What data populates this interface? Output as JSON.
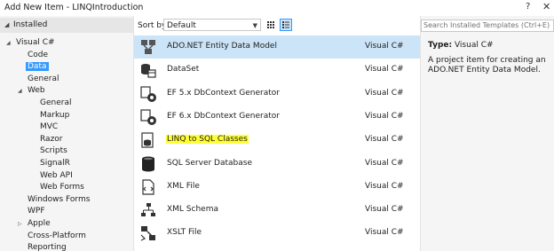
{
  "window": {
    "title": "Add New Item - LINQIntroduction",
    "help": "?",
    "close": "✕"
  },
  "tree": {
    "header": "Installed",
    "items": [
      {
        "label": "Visual C#",
        "indent": 1,
        "expander": "expanded"
      },
      {
        "label": "Code",
        "indent": 2
      },
      {
        "label": "Data",
        "indent": 2,
        "selected": true
      },
      {
        "label": "General",
        "indent": 2
      },
      {
        "label": "Web",
        "indent": 2,
        "expander": "expanded"
      },
      {
        "label": "General",
        "indent": 3
      },
      {
        "label": "Markup",
        "indent": 3
      },
      {
        "label": "MVC",
        "indent": 3
      },
      {
        "label": "Razor",
        "indent": 3
      },
      {
        "label": "Scripts",
        "indent": 3
      },
      {
        "label": "SignalR",
        "indent": 3
      },
      {
        "label": "Web API",
        "indent": 3
      },
      {
        "label": "Web Forms",
        "indent": 3
      },
      {
        "label": "Windows Forms",
        "indent": 2
      },
      {
        "label": "WPF",
        "indent": 2
      },
      {
        "label": "Apple",
        "indent": 2,
        "expander": "collapsed"
      },
      {
        "label": "Cross-Platform",
        "indent": 2
      },
      {
        "label": "Reporting",
        "indent": 2
      }
    ]
  },
  "toolbar": {
    "sort_label": "Sort by:",
    "sort_value": "Default"
  },
  "templates": [
    {
      "name": "ADO.NET Entity Data Model",
      "lang": "Visual C#",
      "icon": "entity-model-icon",
      "selected": true
    },
    {
      "name": "DataSet",
      "lang": "Visual C#",
      "icon": "dataset-icon"
    },
    {
      "name": "EF 5.x DbContext Generator",
      "lang": "Visual C#",
      "icon": "ef5-generator-icon"
    },
    {
      "name": "EF 6.x DbContext Generator",
      "lang": "Visual C#",
      "icon": "ef6-generator-icon"
    },
    {
      "name": "LINQ to SQL Classes",
      "lang": "Visual C#",
      "icon": "linq-to-sql-icon",
      "highlighted": true
    },
    {
      "name": "SQL Server Database",
      "lang": "Visual C#",
      "icon": "database-icon"
    },
    {
      "name": "XML File",
      "lang": "Visual C#",
      "icon": "xml-file-icon"
    },
    {
      "name": "XML Schema",
      "lang": "Visual C#",
      "icon": "xml-schema-icon"
    },
    {
      "name": "XSLT File",
      "lang": "Visual C#",
      "icon": "xslt-file-icon"
    }
  ],
  "details": {
    "search_placeholder": "Search Installed Templates (Ctrl+E)",
    "type_label": "Type:",
    "type_value": "Visual C#",
    "description": "A project item for creating an ADO.NET Entity Data Model."
  },
  "colors": {
    "selection": "#3399ff",
    "row_selected": "#cce4f7",
    "highlight": "#ffff33",
    "panel_bg": "#f5f5f5"
  }
}
